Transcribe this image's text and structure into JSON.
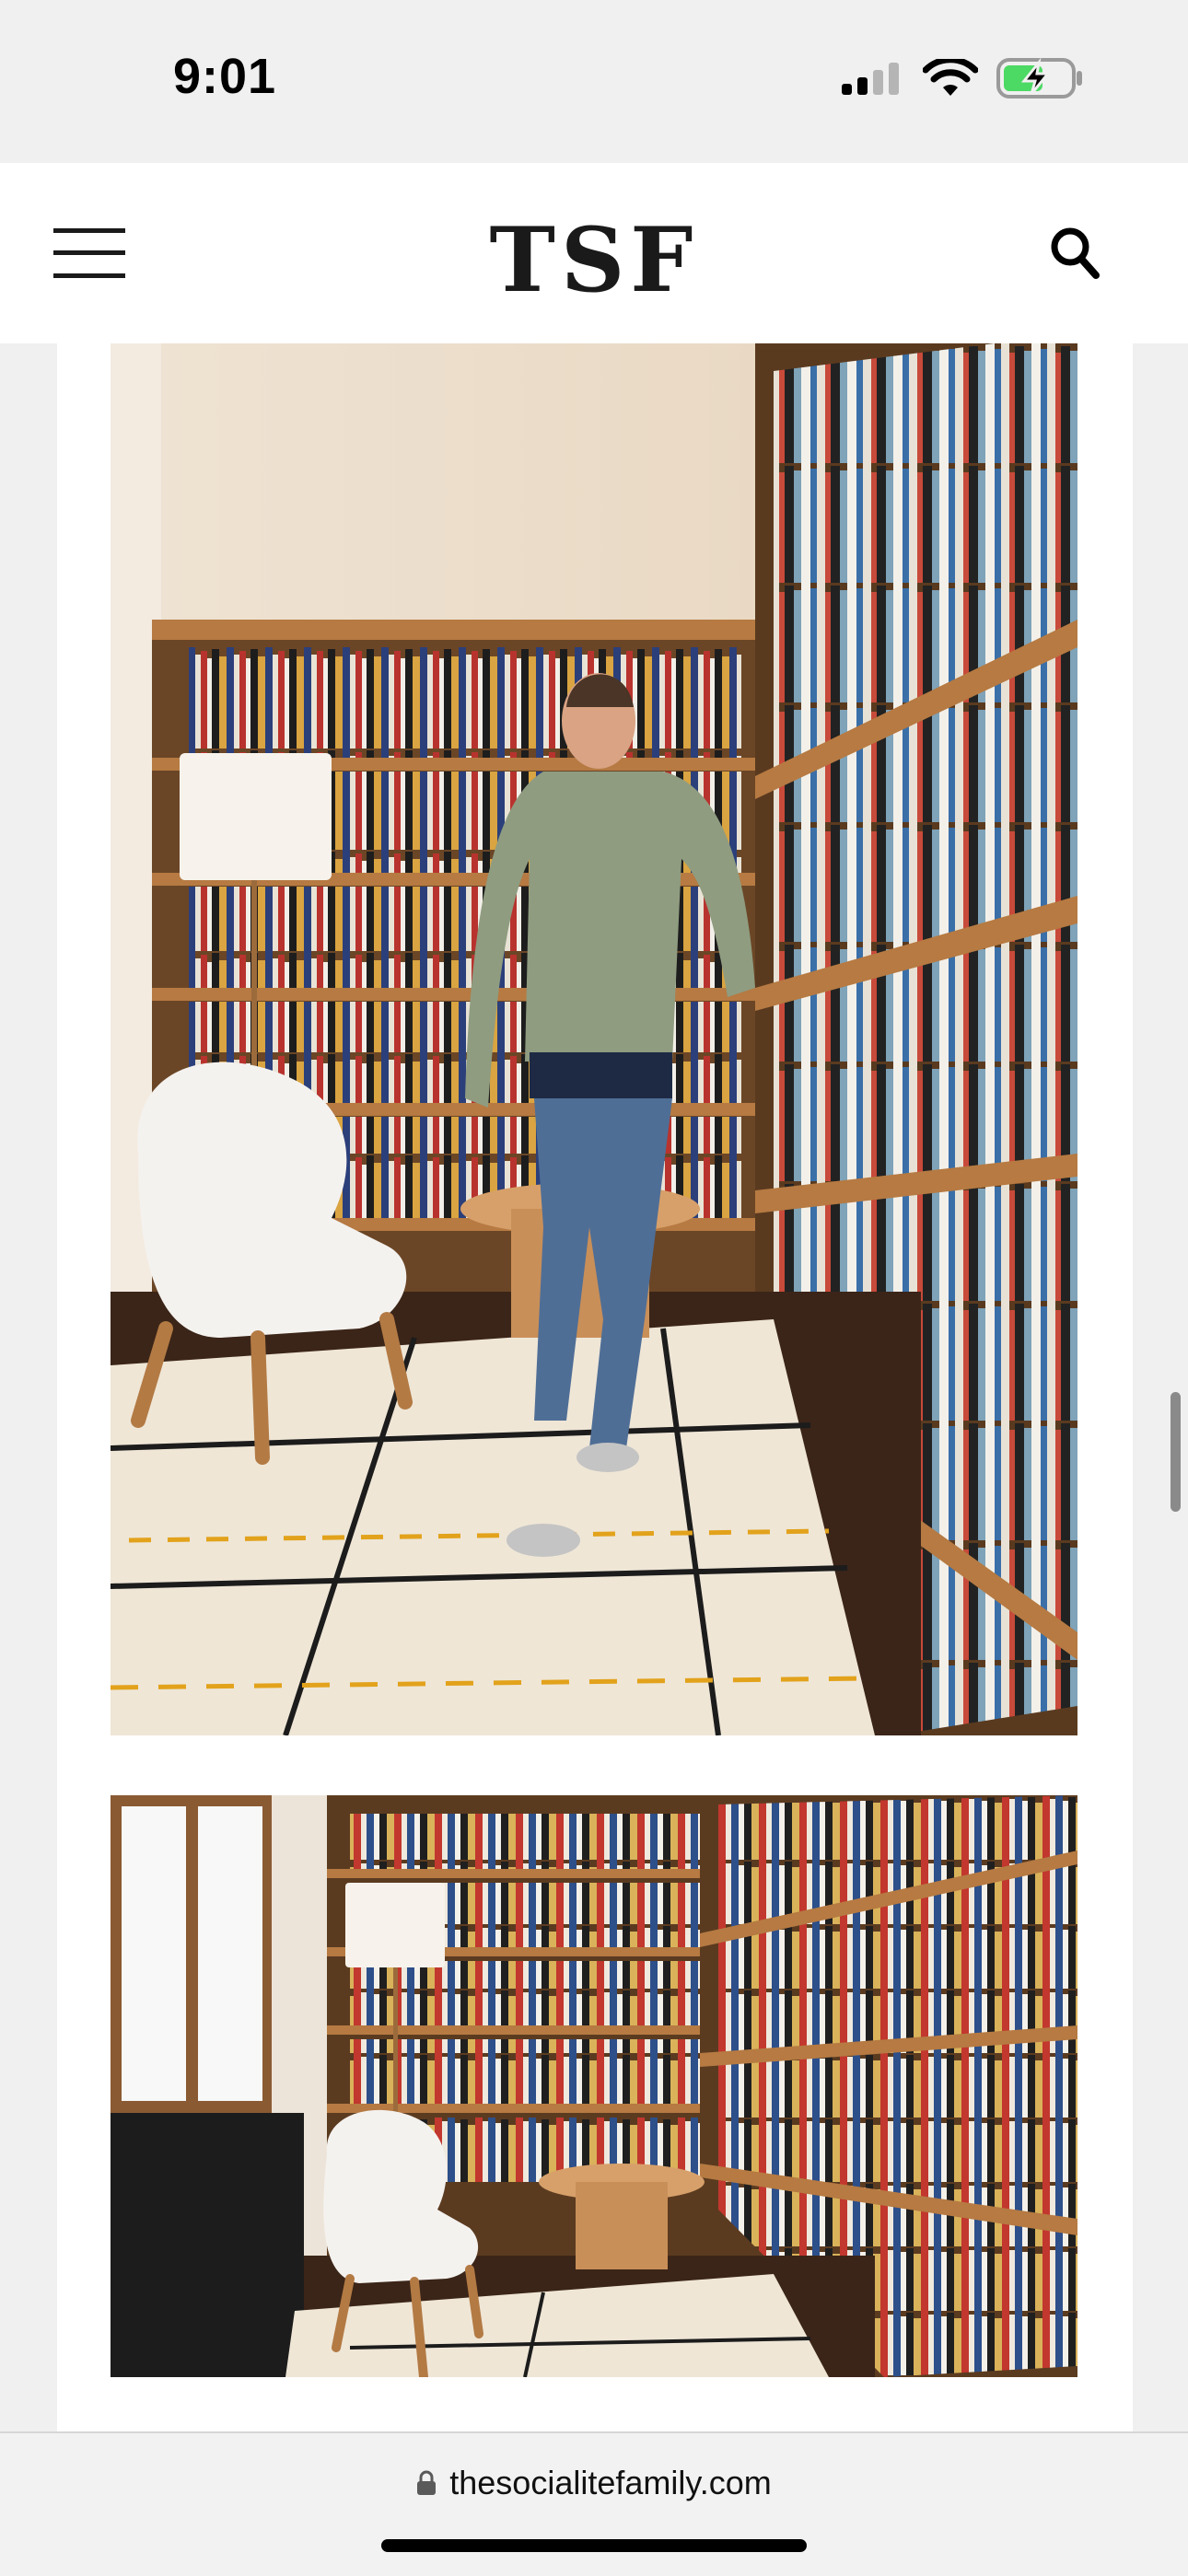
{
  "status_bar": {
    "time": "9:01"
  },
  "header": {
    "logo": "TSF",
    "menu_icon": "hamburger-menu-icon",
    "search_icon": "search-icon"
  },
  "article": {
    "images": [
      {
        "name": "library-portrait-photo"
      },
      {
        "name": "library-room-photo"
      }
    ]
  },
  "browser": {
    "url": "thesocialitefamily.com"
  },
  "colors": {
    "header_bg": "#ffffff",
    "page_bg": "#f0f0f0",
    "battery_charge": "#4cd964"
  }
}
